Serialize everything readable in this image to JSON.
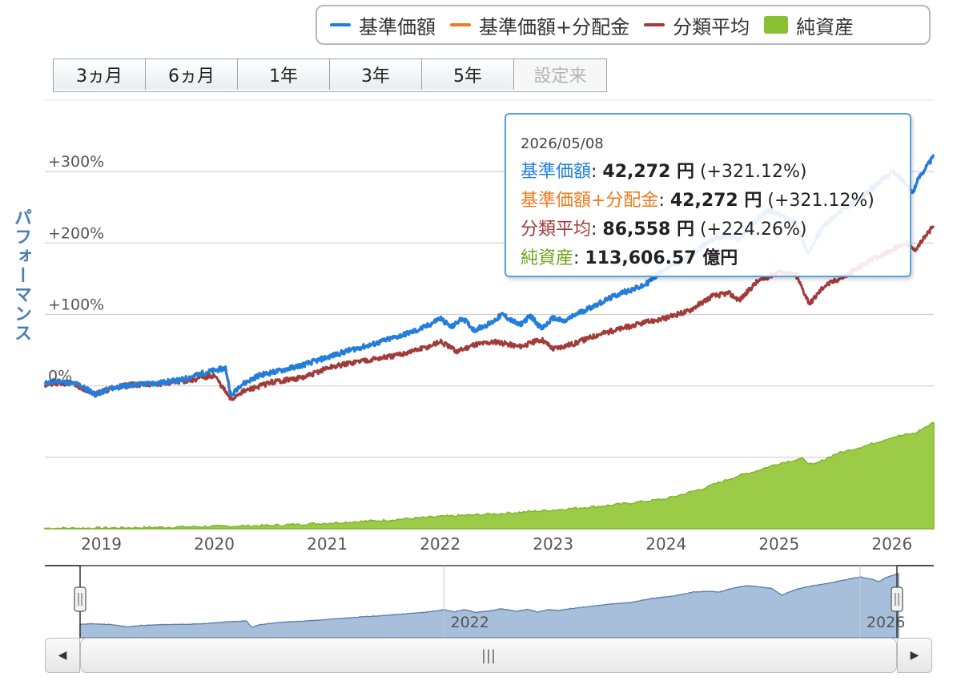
{
  "legend": {
    "items": [
      {
        "label": "基準価額",
        "color": "#1f7fe0",
        "kind": "line"
      },
      {
        "label": "基準価額+分配金",
        "color": "#f07a1c",
        "kind": "line"
      },
      {
        "label": "分類平均",
        "color": "#a33a3a",
        "kind": "line"
      },
      {
        "label": "純資産",
        "color": "#88bf33",
        "kind": "area"
      }
    ]
  },
  "range_buttons": [
    {
      "label": "3ヵ月",
      "enabled": true
    },
    {
      "label": "6ヵ月",
      "enabled": true
    },
    {
      "label": "1年",
      "enabled": true
    },
    {
      "label": "3年",
      "enabled": true
    },
    {
      "label": "5年",
      "enabled": true
    },
    {
      "label": "設定来",
      "enabled": false
    }
  ],
  "y_axis_title": "パフォーマンス",
  "tooltip": {
    "date": "2026/05/08",
    "rows": [
      {
        "label": "基準価額",
        "sep": ": ",
        "value": "42,272 円",
        "extra": " (+321.12%)",
        "color": "#1f7fe0"
      },
      {
        "label": "基準価額+分配金",
        "sep": ": ",
        "value": "42,272 円",
        "extra": " (+321.12%)",
        "color": "#f07a1c"
      },
      {
        "label": "分類平均",
        "sep": ": ",
        "value": "86,558 円",
        "extra": " (+224.26%)",
        "color": "#a33a3a"
      },
      {
        "label": "純資産",
        "sep": ": ",
        "value": "113,606.57 億円",
        "extra": "",
        "color": "#88bf33"
      }
    ]
  },
  "navigator": {
    "tick_labels": [
      "2022",
      "2026"
    ],
    "scroll_thumb_glyph": "|||",
    "left_arrow": "◀",
    "right_arrow": "▶"
  },
  "chart_data": {
    "type": "line",
    "x_ticks": [
      {
        "label": "2019",
        "x": 2019.0
      },
      {
        "label": "2020",
        "x": 2020.0
      },
      {
        "label": "2021",
        "x": 2021.0
      },
      {
        "label": "2022",
        "x": 2022.0
      },
      {
        "label": "2023",
        "x": 2023.0
      },
      {
        "label": "2024",
        "x": 2024.0
      },
      {
        "label": "2025",
        "x": 2025.0
      },
      {
        "label": "2026",
        "x": 2026.0
      }
    ],
    "xlim": [
      2018.5,
      2026.37
    ],
    "y_ticks": [
      {
        "label": "+300%",
        "value": 300
      },
      {
        "label": "+200%",
        "value": 200
      },
      {
        "label": "+100%",
        "value": 100
      },
      {
        "label": "0%",
        "value": 0
      },
      {
        "label": "",
        "value": -100
      }
    ],
    "ylim": [
      -200,
      400
    ],
    "grid": true,
    "legend_position": "top-right",
    "series": [
      {
        "name": "基準価額",
        "color": "#1f7fe0",
        "unit": "%",
        "x": [
          2018.5,
          2018.6,
          2018.8,
          2018.95,
          2019.1,
          2019.3,
          2019.5,
          2019.7,
          2019.9,
          2020.1,
          2020.15,
          2020.22,
          2020.4,
          2020.6,
          2020.8,
          2021.0,
          2021.2,
          2021.4,
          2021.6,
          2021.8,
          2021.9,
          2022.0,
          2022.1,
          2022.2,
          2022.3,
          2022.45,
          2022.55,
          2022.7,
          2022.8,
          2022.9,
          2023.0,
          2023.1,
          2023.2,
          2023.4,
          2023.6,
          2023.8,
          2024.0,
          2024.2,
          2024.4,
          2024.55,
          2024.65,
          2024.75,
          2024.9,
          2025.0,
          2025.15,
          2025.25,
          2025.3,
          2025.4,
          2025.55,
          2025.7,
          2025.85,
          2026.0,
          2026.12,
          2026.18,
          2026.25,
          2026.37
        ],
        "values": [
          3,
          7,
          2,
          -12,
          -3,
          2,
          4,
          8,
          18,
          25,
          -15,
          0,
          15,
          22,
          30,
          40,
          50,
          58,
          68,
          78,
          85,
          95,
          82,
          95,
          78,
          88,
          100,
          85,
          98,
          80,
          95,
          90,
          100,
          115,
          130,
          140,
          165,
          180,
          205,
          210,
          205,
          225,
          245,
          240,
          228,
          185,
          200,
          225,
          245,
          260,
          280,
          300,
          285,
          270,
          295,
          321
        ]
      },
      {
        "name": "基準価額+分配金",
        "color": "#f07a1c",
        "unit": "%",
        "x": [
          2018.5,
          2018.6,
          2018.8,
          2018.95,
          2019.1,
          2019.3,
          2019.5,
          2019.7,
          2019.9,
          2020.1,
          2020.15,
          2020.22,
          2020.4,
          2020.6,
          2020.8,
          2021.0,
          2021.2,
          2021.4,
          2021.6,
          2021.8,
          2021.9,
          2022.0,
          2022.1,
          2022.2,
          2022.3,
          2022.45,
          2022.55,
          2022.7,
          2022.8,
          2022.9,
          2023.0,
          2023.1,
          2023.2,
          2023.4,
          2023.6,
          2023.8,
          2024.0,
          2024.2,
          2024.4,
          2024.55,
          2024.65,
          2024.75,
          2024.9,
          2025.0,
          2025.15,
          2025.25,
          2025.3,
          2025.4,
          2025.55,
          2025.7,
          2025.85,
          2026.0,
          2026.12,
          2026.18,
          2026.25,
          2026.37
        ],
        "values": [
          3,
          7,
          2,
          -12,
          -3,
          2,
          4,
          8,
          18,
          25,
          -15,
          0,
          15,
          22,
          30,
          40,
          50,
          58,
          68,
          78,
          85,
          95,
          82,
          95,
          78,
          88,
          100,
          85,
          98,
          80,
          95,
          90,
          100,
          115,
          130,
          140,
          165,
          180,
          205,
          210,
          205,
          225,
          245,
          240,
          228,
          185,
          200,
          225,
          245,
          260,
          280,
          300,
          285,
          270,
          295,
          321
        ]
      },
      {
        "name": "分類平均",
        "color": "#a33a3a",
        "unit": "%",
        "x": [
          2018.5,
          2018.7,
          2018.95,
          2019.2,
          2019.5,
          2019.8,
          2020.0,
          2020.15,
          2020.22,
          2020.5,
          2020.8,
          2021.0,
          2021.3,
          2021.6,
          2021.9,
          2022.0,
          2022.15,
          2022.3,
          2022.5,
          2022.7,
          2022.9,
          2023.0,
          2023.2,
          2023.4,
          2023.6,
          2023.8,
          2024.0,
          2024.2,
          2024.4,
          2024.55,
          2024.65,
          2024.8,
          2025.0,
          2025.15,
          2025.27,
          2025.4,
          2025.6,
          2025.8,
          2026.0,
          2026.12,
          2026.2,
          2026.37
        ],
        "values": [
          2,
          4,
          -10,
          1,
          3,
          8,
          15,
          -20,
          -10,
          5,
          12,
          25,
          35,
          42,
          55,
          62,
          48,
          58,
          62,
          55,
          65,
          52,
          60,
          72,
          80,
          88,
          95,
          105,
          125,
          130,
          120,
          145,
          160,
          155,
          115,
          140,
          155,
          175,
          190,
          200,
          190,
          224
        ]
      }
    ],
    "net_assets": {
      "name": "純資産",
      "color": "#88bf33",
      "unit": "億円",
      "x": [
        2018.5,
        2019.0,
        2019.5,
        2020.0,
        2020.5,
        2021.0,
        2021.5,
        2022.0,
        2022.5,
        2023.0,
        2023.5,
        2024.0,
        2024.3,
        2024.6,
        2024.8,
        2025.0,
        2025.2,
        2025.3,
        2025.5,
        2025.8,
        2026.0,
        2026.2,
        2026.37
      ],
      "values": [
        500,
        800,
        1500,
        2500,
        3500,
        6000,
        9000,
        13000,
        16000,
        20000,
        25000,
        32000,
        42000,
        55000,
        62000,
        70000,
        75000,
        68000,
        80000,
        90000,
        98000,
        102000,
        113606.57
      ]
    }
  }
}
